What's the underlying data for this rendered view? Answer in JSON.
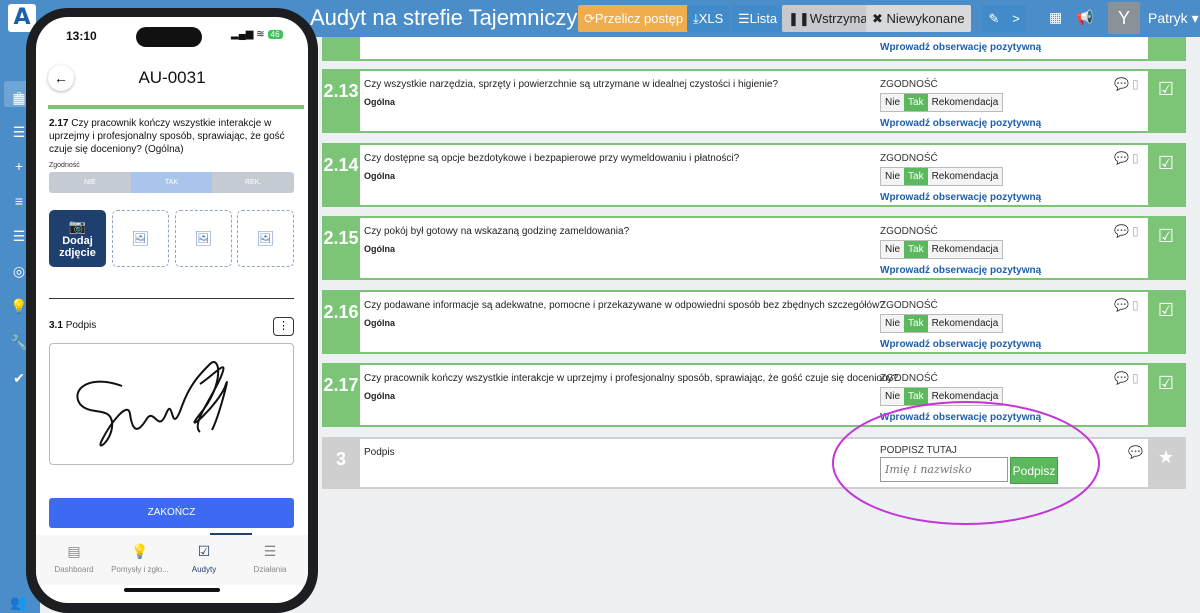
{
  "app": {
    "title": "Audyt na strefie Tajemniczy",
    "logo": "A"
  },
  "toolbar": {
    "recalc": "Przelicz postęp",
    "xls": "XLS",
    "list": "Lista",
    "pause": "Wstrzymaj",
    "undone": "Niewykonane",
    "more": ">"
  },
  "user": {
    "initial": "Y",
    "name": "Patryk"
  },
  "top_obs": "Wprowadź obserwację pozytywną",
  "items": [
    {
      "num": "2.13",
      "question": "Czy wszystkie narzędzia, sprzęty i powierzchnie są utrzymane w idealnej czystości i higienie?",
      "category": "Ogólna",
      "zg": "ZGODNOŚĆ",
      "no": "Nie",
      "yes": "Tak",
      "rec": "Rekomendacja",
      "obs": "Wprowadź obserwację pozytywną"
    },
    {
      "num": "2.14",
      "question": "Czy dostępne są opcje bezdotykowe i bezpapierowe przy wymeldowaniu i płatności?",
      "category": "Ogólna",
      "zg": "ZGODNOŚĆ",
      "no": "Nie",
      "yes": "Tak",
      "rec": "Rekomendacja",
      "obs": "Wprowadź obserwację pozytywną"
    },
    {
      "num": "2.15",
      "question": "Czy pokój był gotowy na wskazaną godzinę zameldowania?",
      "category": "Ogólna",
      "zg": "ZGODNOŚĆ",
      "no": "Nie",
      "yes": "Tak",
      "rec": "Rekomendacja",
      "obs": "Wprowadź obserwację pozytywną"
    },
    {
      "num": "2.16",
      "question": "Czy podawane informacje są adekwatne, pomocne i przekazywane w odpowiedni sposób bez zbędnych szczegółów?",
      "category": "Ogólna",
      "zg": "ZGODNOŚĆ",
      "no": "Nie",
      "yes": "Tak",
      "rec": "Rekomendacja",
      "obs": "Wprowadź obserwację pozytywną"
    },
    {
      "num": "2.17",
      "question": "Czy pracownik kończy wszystkie interakcje w uprzejmy i profesjonalny sposób, sprawiając, że gość czuje się doceniony?",
      "category": "Ogólna",
      "zg": "ZGODNOŚĆ",
      "no": "Nie",
      "yes": "Tak",
      "rec": "Rekomendacja",
      "obs": "Wprowadź obserwację pozytywną"
    }
  ],
  "signature": {
    "num": "3",
    "question": "Podpis",
    "label": "PODPISZ TUTAJ",
    "placeholder": "Imię i nazwisko",
    "button": "Podpisz"
  },
  "phone": {
    "time": "13:10",
    "battery": "46",
    "header": "AU-0031",
    "question_num": "2.17",
    "question": "Czy pracownik kończy wszystkie interakcje w uprzejmy i profesjonalny sposób, sprawiając, że gość czuje się doceniony? (Ogólna)",
    "zgodnosc": "Zgodność",
    "seg_no": "NIE",
    "seg_yes": "TAK",
    "seg_rek": "REK.",
    "add_photo": "Dodaj zdjęcie",
    "sig_num": "3.1",
    "sig_label": "Podpis",
    "finish": "ZAKOŃCZ",
    "tabs": [
      "Dashboard",
      "Pomysły i zgło...",
      "Audyty",
      "Działania"
    ]
  },
  "colors": {
    "brand": "#4a8dc8",
    "green": "#7cc576",
    "highlight": "#c436d6",
    "navy": "#1f3f6e"
  }
}
